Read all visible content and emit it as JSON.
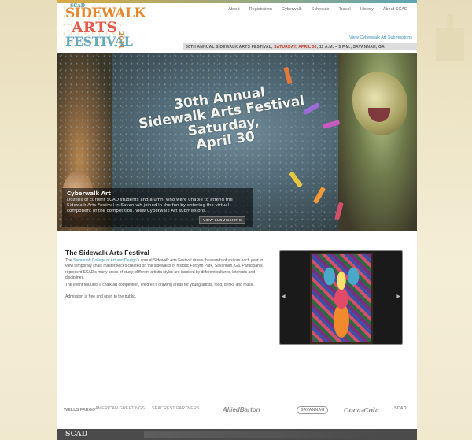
{
  "header": {
    "logo": {
      "scad": "SCAD",
      "line1": "SIDEWALK",
      "line2": "ARTS",
      "line3": "FESTIVAL",
      "year": "2011"
    },
    "nav": [
      "About",
      "Registration",
      "Cyberwalk",
      "Schedule",
      "Travel",
      "History",
      "About SCAD"
    ],
    "submissions_link": "View Cyberwalk Art Submissions",
    "tagline": {
      "part1": "30TH ANNUAL SIDEWALK ARTS FESTIVAL, ",
      "highlight": "SATURDAY, APRIL 30",
      "part2": ", 11 A.M. – 5 P.M., SAVANNAH, GA."
    }
  },
  "hero": {
    "title_lines": [
      "30th Annual",
      "Sidewalk Arts Festival",
      "Saturday,",
      "April 30"
    ],
    "caption": {
      "title": "Cyberwalk Art",
      "text": "Dozens of current SCAD students and alumni who were unable to attend the Sidewalk Arts Festival in Savannah joined in the fun by entering the virtual component of the competition. View Cyberwalk Art submissions.",
      "button": "VIEW SUBMISSIONS"
    }
  },
  "content": {
    "heading": "The Sidewalk Arts Festival",
    "p1_link": "Savannah College of Art and Design",
    "p1_prefix": "The ",
    "p1_rest": "'s annual Sidewalk Arts Festival draws thousands of visitors each year to view temporary chalk masterpieces created on the sidewalks of historic Forsyth Park, Savannah, Ga. Participants represent SCAD's many areas of study; different artistic styles are inspired by different cultures, interests and disciplines.",
    "p2": "The event features a chalk art competition, children's drawing areas for young artists, food, drinks and music.",
    "p3": "Admission is free and open to the public."
  },
  "sponsors": [
    "WELLS FARGO",
    "AMERICAN GREETINGS",
    "SEACREST PARTNERS",
    "AlliedBarton",
    "SAVANNAH",
    "Coca-Cola",
    "SCAD"
  ],
  "footer": {
    "logo": "SCAD"
  }
}
